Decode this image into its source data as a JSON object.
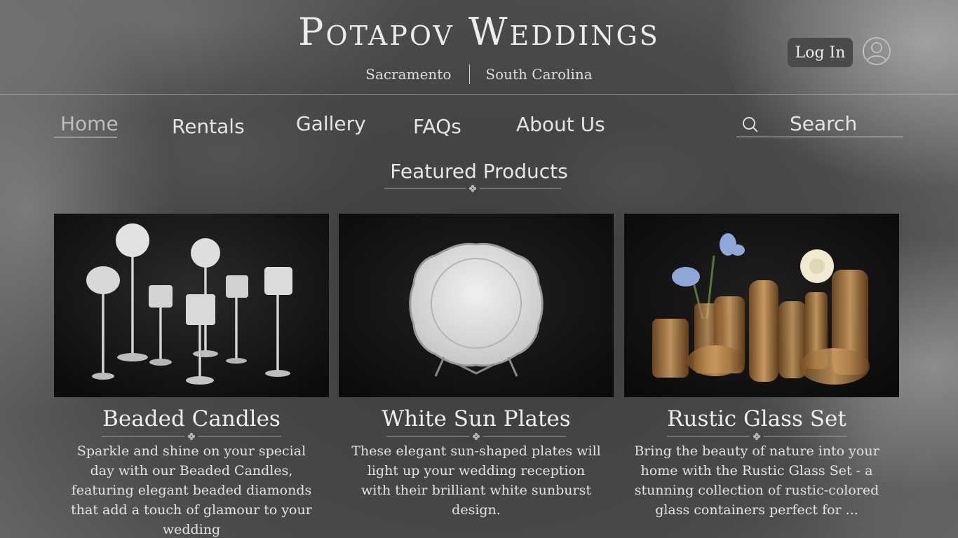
{
  "brand": {
    "title": "Potapov Weddings",
    "locations": [
      "Sacramento",
      "South Carolina"
    ]
  },
  "header": {
    "login_label": "Log In"
  },
  "nav": {
    "items": [
      {
        "label": "Home",
        "active": true
      },
      {
        "label": "Rentals",
        "active": false
      },
      {
        "label": "Gallery",
        "active": false
      },
      {
        "label": "FAQs",
        "active": false
      },
      {
        "label": "About Us",
        "active": false
      }
    ]
  },
  "search": {
    "placeholder": "Search",
    "icon": "search-icon"
  },
  "featured": {
    "title": "Featured Products",
    "products": [
      {
        "title": "Beaded Candles",
        "image": "beaded-candle-holders-photo",
        "description": "Sparkle and shine on your special day with our Beaded Candles, featuring elegant beaded diamonds that add a touch of glamour to your wedding"
      },
      {
        "title": "White Sun Plates",
        "image": "white-sun-plate-photo",
        "description": "These elegant sun-shaped plates will light up your wedding reception with their brilliant white sunburst design."
      },
      {
        "title": "Rustic Glass Set",
        "image": "rustic-glass-vases-photo",
        "description": "Bring the beauty of nature into your home with the Rustic Glass Set - a stunning collection of rustic-colored glass containers perfect for ..."
      }
    ]
  },
  "colors": {
    "text": "#ececec",
    "login_bg": "#4a4a4a",
    "card_bg": "#141414"
  }
}
